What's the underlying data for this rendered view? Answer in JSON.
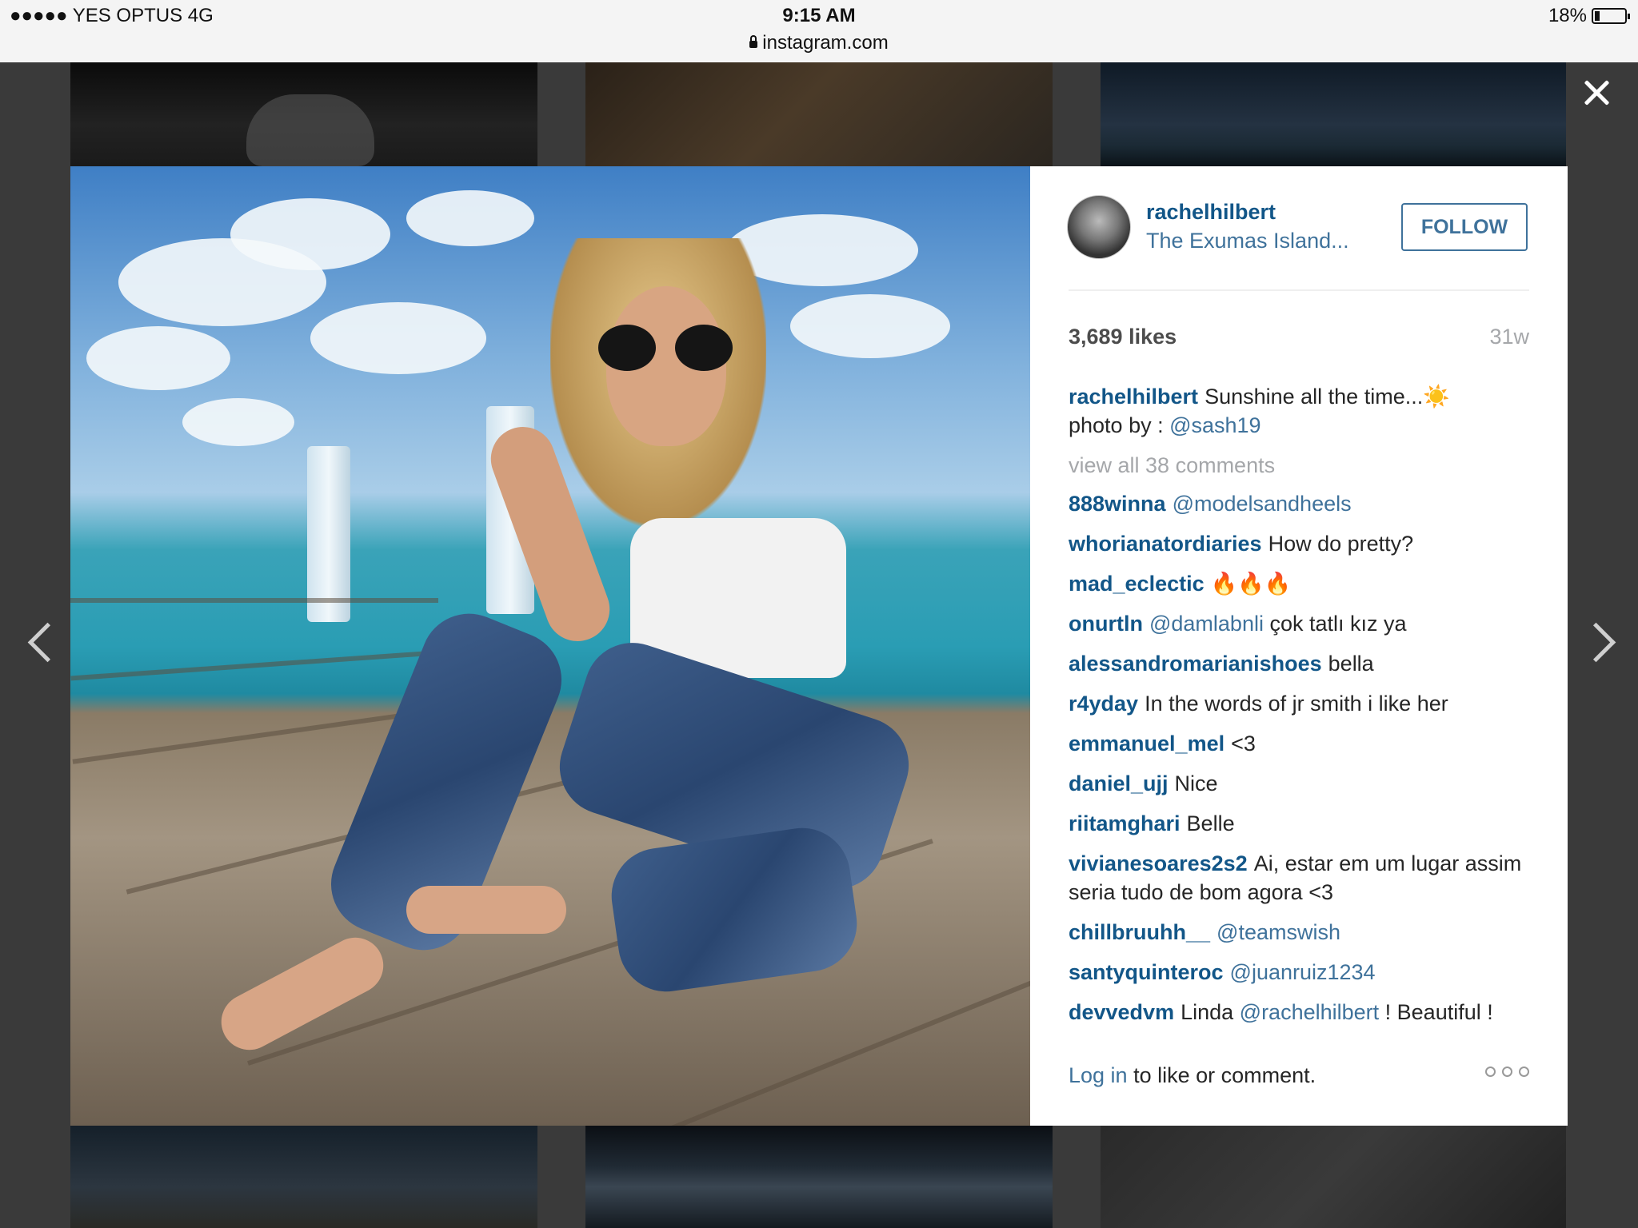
{
  "status_bar": {
    "carrier": "●●●●● YES OPTUS   4G",
    "time": "9:15 AM",
    "url": "instagram.com",
    "battery_text": "18%",
    "battery_level": 0.18
  },
  "post": {
    "username": "rachelhilbert",
    "location": "The Exumas Island...",
    "follow_label": "FOLLOW",
    "likes": "3,689 likes",
    "age": "31w",
    "caption": {
      "user": "rachelhilbert",
      "text": "Sunshine all the time...☀️",
      "line2_prefix": "photo by : ",
      "mention": "@sash19"
    },
    "view_all": "view all 38 comments",
    "comments": [
      {
        "user": "888winna",
        "text": "",
        "mention": "@modelsandheels"
      },
      {
        "user": "whorianatordiaries",
        "text": "How do pretty?",
        "mention": ""
      },
      {
        "user": "mad_eclectic",
        "text": "🔥🔥🔥",
        "mention": ""
      },
      {
        "user": "onurtln",
        "text": " çok tatlı kız ya",
        "mention": "@damlabnli"
      },
      {
        "user": "alessandromarianishoes",
        "text": "bella",
        "mention": ""
      },
      {
        "user": "r4yday",
        "text": "In the words of jr smith i like her",
        "mention": ""
      },
      {
        "user": "emmanuel_mel",
        "text": "<3",
        "mention": ""
      },
      {
        "user": "daniel_ujj",
        "text": "Nice",
        "mention": ""
      },
      {
        "user": "riitamghari",
        "text": "Belle",
        "mention": ""
      },
      {
        "user": "vivianesoares2s2",
        "text": "Ai, estar em um lugar assim seria tudo de bom agora <3",
        "mention": ""
      },
      {
        "user": "chillbruuhh__",
        "text": "",
        "mention": "@teamswish"
      },
      {
        "user": "santyquinteroc",
        "text": "",
        "mention": "@juanruiz1234"
      },
      {
        "user": "devvedvm",
        "text": "Linda ",
        "mention": "@rachelhilbert"
      }
    ],
    "last_comment_tail": " ! Beautiful !",
    "login_link": "Log in",
    "login_text": " to like or comment."
  }
}
